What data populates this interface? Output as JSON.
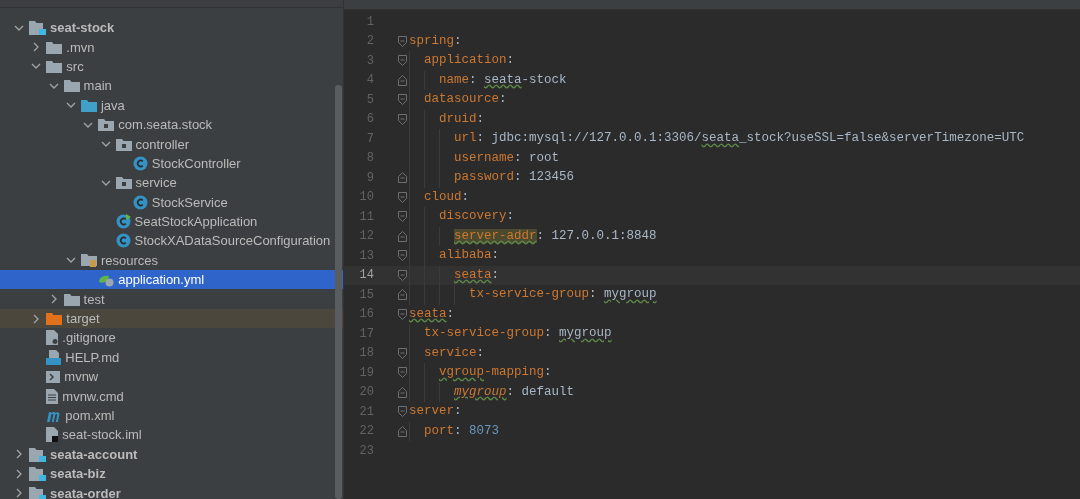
{
  "project_tree": [
    {
      "kind": "module",
      "label": "seat-stock",
      "expanded": true,
      "selected": false,
      "children": [
        {
          "kind": "folder",
          "label": ".mvn",
          "expanded": false,
          "selected": false
        },
        {
          "kind": "folder",
          "label": "src",
          "expanded": true,
          "selected": false,
          "children": [
            {
              "kind": "folder",
              "label": "main",
              "expanded": true,
              "selected": false,
              "children": [
                {
                  "kind": "source_folder",
                  "label": "java",
                  "expanded": true,
                  "selected": false,
                  "children": [
                    {
                      "kind": "package",
                      "label": "com.seata.stock",
                      "expanded": true,
                      "selected": false,
                      "children": [
                        {
                          "kind": "package",
                          "label": "controller",
                          "expanded": true,
                          "selected": false,
                          "children": [
                            {
                              "kind": "class",
                              "label": "StockController",
                              "selected": false
                            }
                          ]
                        },
                        {
                          "kind": "package",
                          "label": "service",
                          "expanded": true,
                          "selected": false,
                          "children": [
                            {
                              "kind": "class",
                              "label": "StockService",
                              "selected": false
                            }
                          ]
                        },
                        {
                          "kind": "spring_class",
                          "label": "SeatStockApplication",
                          "selected": false
                        },
                        {
                          "kind": "class",
                          "label": "StockXADataSourceConfiguration",
                          "selected": false
                        }
                      ]
                    }
                  ]
                },
                {
                  "kind": "resources_folder",
                  "label": "resources",
                  "expanded": true,
                  "selected": false,
                  "children": [
                    {
                      "kind": "spring_config",
                      "label": "application.yml",
                      "selected": true
                    }
                  ]
                }
              ]
            },
            {
              "kind": "folder",
              "label": "test",
              "expanded": false,
              "selected": false
            }
          ]
        },
        {
          "kind": "excluded_folder",
          "label": "target",
          "expanded": false,
          "selected": false
        },
        {
          "kind": "ignore_file",
          "label": ".gitignore",
          "selected": false
        },
        {
          "kind": "markdown",
          "label": "HELP.md",
          "selected": false
        },
        {
          "kind": "script",
          "label": "mvnw",
          "selected": false
        },
        {
          "kind": "text_file",
          "label": "mvnw.cmd",
          "selected": false
        },
        {
          "kind": "maven",
          "label": "pom.xml",
          "selected": false
        },
        {
          "kind": "iml",
          "label": "seat-stock.iml",
          "selected": false
        }
      ]
    },
    {
      "kind": "module",
      "label": "seata-account",
      "expanded": false,
      "selected": false
    },
    {
      "kind": "module",
      "label": "seata-biz",
      "expanded": false,
      "selected": false
    },
    {
      "kind": "module",
      "label": "seata-order",
      "expanded": false,
      "selected": false
    }
  ],
  "editor_lines": [
    {
      "number": "1",
      "current": false,
      "kind": "plain"
    },
    {
      "number": "2",
      "current": false,
      "kind": "fold_start",
      "tokens": [
        {
          "text": "spring",
          "kind": "key",
          "typo": false
        },
        {
          "text": ":",
          "kind": "punct",
          "typo": false
        }
      ],
      "children": [
        {
          "number": "3",
          "current": false,
          "kind": "fold_start",
          "tokens": [
            {
              "text": "application",
              "kind": "key",
              "typo": false
            },
            {
              "text": ":",
              "kind": "punct",
              "typo": false
            }
          ],
          "children": [
            {
              "number": "4",
              "current": false,
              "kind": "fold_end",
              "tokens": [
                {
                  "text": "name",
                  "kind": "key",
                  "typo": false
                },
                {
                  "text": ": ",
                  "kind": "punct",
                  "typo": false
                },
                {
                  "text": "seata",
                  "kind": "value",
                  "typo": true
                },
                {
                  "text": "-stock",
                  "kind": "value",
                  "typo": false
                }
              ]
            }
          ]
        },
        {
          "number": "5",
          "current": false,
          "kind": "fold_start",
          "tokens": [
            {
              "text": "datasource",
              "kind": "key",
              "typo": false
            },
            {
              "text": ":",
              "kind": "punct",
              "typo": false
            }
          ],
          "children": [
            {
              "number": "6",
              "current": false,
              "kind": "fold_start",
              "tokens": [
                {
                  "text": "druid",
                  "kind": "key",
                  "typo": false
                },
                {
                  "text": ":",
                  "kind": "punct",
                  "typo": false
                }
              ],
              "children": [
                {
                  "number": "7",
                  "current": false,
                  "kind": "plain",
                  "tokens": [
                    {
                      "text": "url",
                      "kind": "key",
                      "typo": false
                    },
                    {
                      "text": ": ",
                      "kind": "punct",
                      "typo": false
                    },
                    {
                      "text": "jdbc:mysql://127.0.0.1:3306/",
                      "kind": "value",
                      "typo": false
                    },
                    {
                      "text": "seata",
                      "kind": "value",
                      "typo": true
                    },
                    {
                      "text": "_stock?useSSL=false&serverTimezone=UTC",
                      "kind": "value",
                      "typo": false
                    }
                  ]
                },
                {
                  "number": "8",
                  "current": false,
                  "kind": "plain",
                  "tokens": [
                    {
                      "text": "username",
                      "kind": "key",
                      "typo": false
                    },
                    {
                      "text": ": ",
                      "kind": "punct",
                      "typo": false
                    },
                    {
                      "text": "root",
                      "kind": "value",
                      "typo": false
                    }
                  ]
                },
                {
                  "number": "9",
                  "current": false,
                  "kind": "fold_end",
                  "tokens": [
                    {
                      "text": "password",
                      "kind": "key",
                      "typo": false
                    },
                    {
                      "text": ": ",
                      "kind": "punct",
                      "typo": false
                    },
                    {
                      "text": "123456",
                      "kind": "value",
                      "typo": false
                    }
                  ]
                }
              ]
            }
          ]
        },
        {
          "number": "10",
          "current": false,
          "kind": "fold_start",
          "tokens": [
            {
              "text": "cloud",
              "kind": "key",
              "typo": false
            },
            {
              "text": ":",
              "kind": "punct",
              "typo": false
            }
          ],
          "children": [
            {
              "number": "11",
              "current": false,
              "kind": "fold_start",
              "tokens": [
                {
                  "text": "discovery",
                  "kind": "key",
                  "typo": false
                },
                {
                  "text": ":",
                  "kind": "punct",
                  "typo": false
                }
              ],
              "children": [
                {
                  "number": "12",
                  "current": false,
                  "kind": "fold_end",
                  "tokens": [
                    {
                      "text": "server-addr",
                      "kind": "key_marked",
                      "typo": true
                    },
                    {
                      "text": ": ",
                      "kind": "punct",
                      "typo": false
                    },
                    {
                      "text": "127.0.0.1:8848",
                      "kind": "value",
                      "typo": false
                    }
                  ]
                }
              ]
            },
            {
              "number": "13",
              "current": false,
              "kind": "fold_start",
              "tokens": [
                {
                  "text": "alibaba",
                  "kind": "key",
                  "typo": false
                },
                {
                  "text": ":",
                  "kind": "punct",
                  "typo": false
                }
              ],
              "children": [
                {
                  "number": "14",
                  "current": true,
                  "kind": "fold_start",
                  "tokens": [
                    {
                      "text": "seata",
                      "kind": "key",
                      "typo": true
                    },
                    {
                      "text": ":",
                      "kind": "punct",
                      "typo": false
                    }
                  ],
                  "children": [
                    {
                      "number": "15",
                      "current": false,
                      "kind": "fold_end",
                      "tokens": [
                        {
                          "text": "tx-service-group",
                          "kind": "key",
                          "typo": false
                        },
                        {
                          "text": ": ",
                          "kind": "punct",
                          "typo": false
                        },
                        {
                          "text": "mygroup",
                          "kind": "value",
                          "typo": true
                        }
                      ]
                    }
                  ]
                }
              ]
            }
          ]
        }
      ]
    },
    {
      "number": "16",
      "current": false,
      "kind": "fold_start",
      "tokens": [
        {
          "text": "seata",
          "kind": "key",
          "typo": true
        },
        {
          "text": ":",
          "kind": "punct",
          "typo": false
        }
      ],
      "children": [
        {
          "number": "17",
          "current": false,
          "kind": "plain",
          "tokens": [
            {
              "text": "tx-service-group",
              "kind": "key",
              "typo": false
            },
            {
              "text": ": ",
              "kind": "punct",
              "typo": false
            },
            {
              "text": "mygroup",
              "kind": "value",
              "typo": true
            }
          ]
        },
        {
          "number": "18",
          "current": false,
          "kind": "fold_start",
          "tokens": [
            {
              "text": "service",
              "kind": "key",
              "typo": false
            },
            {
              "text": ":",
              "kind": "punct",
              "typo": false
            }
          ],
          "children": [
            {
              "number": "19",
              "current": false,
              "kind": "fold_start",
              "tokens": [
                {
                  "text": "vgroup",
                  "kind": "key",
                  "typo": true
                },
                {
                  "text": "-mapping",
                  "kind": "key",
                  "typo": false
                },
                {
                  "text": ":",
                  "kind": "punct",
                  "typo": false
                }
              ],
              "children": [
                {
                  "number": "20",
                  "current": false,
                  "kind": "fold_end",
                  "tokens": [
                    {
                      "text": "mygroup",
                      "kind": "key_italic",
                      "typo": true
                    },
                    {
                      "text": ": ",
                      "kind": "punct",
                      "typo": false
                    },
                    {
                      "text": "default",
                      "kind": "value",
                      "typo": false
                    }
                  ]
                }
              ]
            }
          ]
        }
      ]
    },
    {
      "number": "21",
      "current": false,
      "kind": "fold_start",
      "tokens": [
        {
          "text": "server",
          "kind": "key",
          "typo": false
        },
        {
          "text": ":",
          "kind": "punct",
          "typo": false
        }
      ],
      "children": [
        {
          "number": "22",
          "current": false,
          "kind": "fold_end",
          "tokens": [
            {
              "text": "port",
              "kind": "key",
              "typo": false
            },
            {
              "text": ": ",
              "kind": "punct",
              "typo": false
            },
            {
              "text": "8073",
              "kind": "number",
              "typo": false
            }
          ]
        }
      ]
    },
    {
      "number": "23",
      "current": false,
      "kind": "plain"
    }
  ]
}
